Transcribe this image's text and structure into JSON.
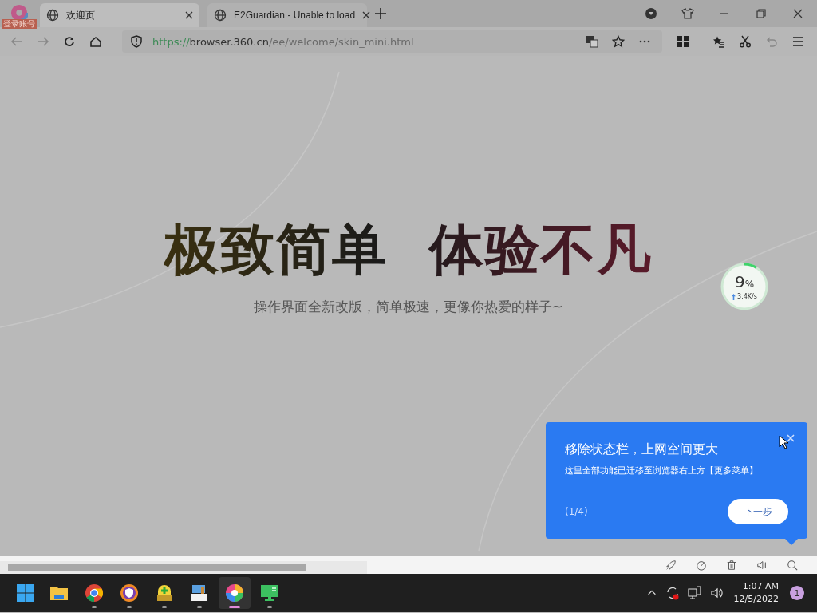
{
  "account_badge": "登录账号",
  "tabs": [
    {
      "label": "欢迎页",
      "selected": true
    },
    {
      "label": "E2Guardian - Unable to load",
      "selected": false
    }
  ],
  "address_bar": {
    "scheme": "https://",
    "host": "browser.360.cn",
    "path": "/ee/welcome/skin_mini.html"
  },
  "hero": {
    "headline": "极致简单  体验不凡",
    "subtitle": "操作界面全新改版，简单极速，更像你热爱的样子~"
  },
  "speed_widget": {
    "percent": "9",
    "unit": "%",
    "rate": "3.4K/s",
    "level": 0.09
  },
  "guide_popup": {
    "title": "移除状态栏，上网空间更大",
    "text": "这里全部功能已迁移至浏览器右上方【更多菜单】",
    "step": "(1/4)",
    "next_button": "下一步"
  },
  "taskbar": {
    "apps": [
      {
        "kind": "explorer",
        "running": false,
        "selected": false
      },
      {
        "kind": "chrome",
        "running": true,
        "selected": false
      },
      {
        "kind": "shield",
        "running": true,
        "selected": false
      },
      {
        "kind": "installer",
        "running": true,
        "selected": false
      },
      {
        "kind": "box",
        "running": true,
        "selected": false
      },
      {
        "kind": "browser360",
        "running": true,
        "selected": true
      },
      {
        "kind": "monitor",
        "running": true,
        "selected": false
      }
    ],
    "time": "1:07 AM",
    "date": "12/5/2022",
    "notifications": "1"
  }
}
